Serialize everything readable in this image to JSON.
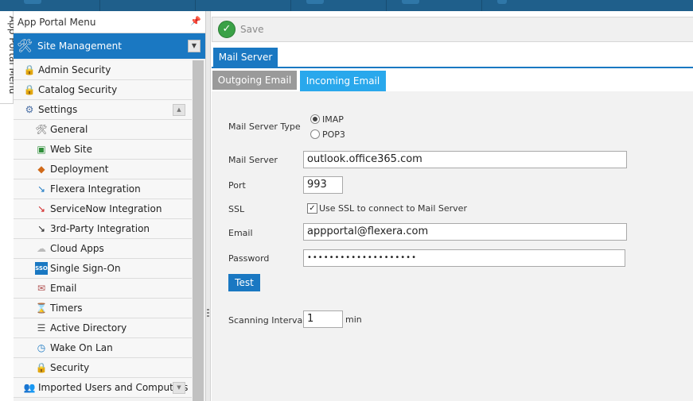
{
  "sidebar_vertical_tab": "App Portal Menu",
  "panel": {
    "title": "App Portal Menu",
    "pin_icon": "pin-icon",
    "section": "Site Management",
    "items": [
      {
        "label": "Admin Security",
        "icon": "lock-icon",
        "glyph": "🔒",
        "level": 0
      },
      {
        "label": "Catalog Security",
        "icon": "lock-icon",
        "glyph": "🔒",
        "level": 0
      },
      {
        "label": "Settings",
        "icon": "gear-icon",
        "glyph": "⚙",
        "level": 0
      },
      {
        "label": "General",
        "icon": "tools-icon",
        "glyph": "🛠",
        "level": 1
      },
      {
        "label": "Web Site",
        "icon": "website-icon",
        "glyph": "▣",
        "level": 1
      },
      {
        "label": "Deployment",
        "icon": "deployment-icon",
        "glyph": "◆",
        "level": 1
      },
      {
        "label": "Flexera Integration",
        "icon": "flexera-icon",
        "glyph": "↘",
        "level": 1
      },
      {
        "label": "ServiceNow Integration",
        "icon": "servicenow-icon",
        "glyph": "↘",
        "level": 1
      },
      {
        "label": "3rd-Party Integration",
        "icon": "third-party-icon",
        "glyph": "↘",
        "level": 1
      },
      {
        "label": "Cloud Apps",
        "icon": "cloud-icon",
        "glyph": "☁",
        "level": 1
      },
      {
        "label": "Single Sign-On",
        "icon": "sso-icon",
        "glyph": "SSO",
        "level": 1
      },
      {
        "label": "Email",
        "icon": "email-icon",
        "glyph": "✉",
        "level": 1
      },
      {
        "label": "Timers",
        "icon": "hourglass-icon",
        "glyph": "⌛",
        "level": 1
      },
      {
        "label": "Active Directory",
        "icon": "directory-icon",
        "glyph": "☰",
        "level": 1
      },
      {
        "label": "Wake On Lan",
        "icon": "clock-icon",
        "glyph": "◷",
        "level": 1
      },
      {
        "label": "Security",
        "icon": "lock-icon",
        "glyph": "🔒",
        "level": 1
      },
      {
        "label": "Imported Users and Computers",
        "icon": "users-icon",
        "glyph": "👥",
        "level": 0
      }
    ]
  },
  "toolbar": {
    "save_label": "Save"
  },
  "tabs": {
    "primary": "Mail Server",
    "outgoing": "Outgoing Email",
    "incoming": "Incoming Email"
  },
  "form": {
    "mail_server_type_label": "Mail Server Type",
    "imap_label": "IMAP",
    "pop3_label": "POP3",
    "mail_server_label": "Mail Server",
    "mail_server_value": "outlook.office365.com",
    "port_label": "Port",
    "port_value": "993",
    "ssl_label": "SSL",
    "ssl_checkbox_label": "Use SSL to connect to Mail Server",
    "email_label": "Email",
    "email_value": "appportal@flexera.com",
    "password_label": "Password",
    "password_value": "••••••••••••••••••••",
    "test_label": "Test",
    "scanning_label": "Scanning Interval",
    "scanning_value": "1",
    "scanning_unit": "min"
  },
  "colors": {
    "accent": "#1a78c2",
    "tab_active": "#29a8ec",
    "tab_inactive": "#9a9a9a"
  }
}
